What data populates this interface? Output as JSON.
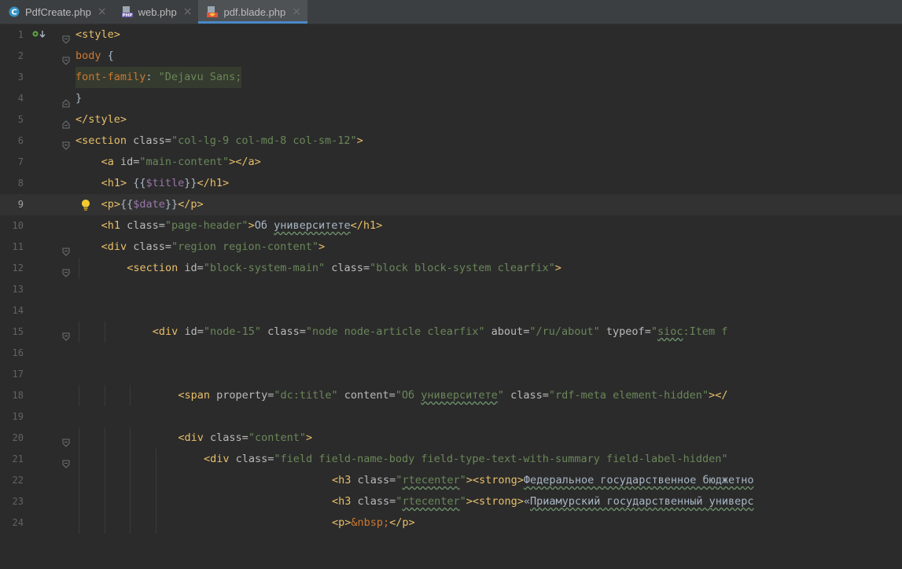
{
  "tabs": [
    {
      "label": "PdfCreate.php",
      "icon": "php-class-icon",
      "active": false
    },
    {
      "label": "web.php",
      "icon": "php-file-icon",
      "active": false
    },
    {
      "label": "pdf.blade.php",
      "icon": "blade-file-icon",
      "active": true
    }
  ],
  "tab_close_glyph": "×",
  "colors": {
    "tag": "#e8bf6a",
    "string": "#6a8759",
    "variable": "#9876aa",
    "text": "#a9b7c6",
    "keyword": "#cc7832",
    "active_tab_underline": "#4a88c7"
  },
  "lines": [
    {
      "n": "1",
      "indent": 0,
      "fold": "open",
      "mark": "implemented",
      "segs": [
        [
          "tag",
          "<style>"
        ]
      ]
    },
    {
      "n": "2",
      "indent": 0,
      "fold": "open",
      "segs": [
        [
          "css",
          "body"
        ],
        [
          "text",
          " {"
        ]
      ]
    },
    {
      "n": "3",
      "indent": 0,
      "cssbg": true,
      "segs": [
        [
          "css",
          "font-family"
        ],
        [
          "text",
          ": "
        ],
        [
          "str",
          "\"Dejavu Sans;"
        ]
      ]
    },
    {
      "n": "4",
      "indent": 0,
      "fold": "close",
      "segs": [
        [
          "text",
          "}"
        ]
      ]
    },
    {
      "n": "5",
      "indent": 0,
      "fold": "close",
      "segs": [
        [
          "tag",
          "</style>"
        ]
      ]
    },
    {
      "n": "6",
      "indent": 0,
      "fold": "open",
      "segs": [
        [
          "tag",
          "<section "
        ],
        [
          "attr",
          "class="
        ],
        [
          "str",
          "\"col-lg-9 col-md-8 col-sm-12\""
        ],
        [
          "tag",
          ">"
        ]
      ]
    },
    {
      "n": "7",
      "indent": 1,
      "segs": [
        [
          "tag",
          "<a "
        ],
        [
          "attr",
          "id="
        ],
        [
          "str",
          "\"main-content\""
        ],
        [
          "tag",
          "></a>"
        ]
      ]
    },
    {
      "n": "8",
      "indent": 1,
      "segs": [
        [
          "tag",
          "<h1>"
        ],
        [
          "text",
          " {{"
        ],
        [
          "var",
          "$title"
        ],
        [
          "text",
          "}}"
        ],
        [
          "tag",
          "</h1>"
        ]
      ]
    },
    {
      "n": "9",
      "indent": 1,
      "current": true,
      "bulb": true,
      "segs": [
        [
          "tag",
          "<p>"
        ],
        [
          "text",
          "{{"
        ],
        [
          "var",
          "$date"
        ],
        [
          "text",
          "}}"
        ],
        [
          "tag",
          "</p>"
        ]
      ]
    },
    {
      "n": "10",
      "indent": 1,
      "segs": [
        [
          "tag",
          "<h1 "
        ],
        [
          "attr",
          "class="
        ],
        [
          "str",
          "\"page-header\""
        ],
        [
          "tag",
          ">"
        ],
        [
          "text",
          "Об "
        ],
        [
          "textsq",
          "университете"
        ],
        [
          "tag",
          "</h1>"
        ]
      ]
    },
    {
      "n": "11",
      "indent": 1,
      "fold": "open",
      "segs": [
        [
          "tag",
          "<div "
        ],
        [
          "attr",
          "class="
        ],
        [
          "str",
          "\"region region-content\""
        ],
        [
          "tag",
          ">"
        ]
      ]
    },
    {
      "n": "12",
      "indent": 2,
      "fold": "open",
      "segs": [
        [
          "tag",
          "<section "
        ],
        [
          "attr",
          "id="
        ],
        [
          "str",
          "\"block-system-main\" "
        ],
        [
          "attr",
          "class="
        ],
        [
          "str",
          "\"block block-system clearfix\""
        ],
        [
          "tag",
          ">"
        ]
      ]
    },
    {
      "n": "13",
      "indent": 0,
      "segs": []
    },
    {
      "n": "14",
      "indent": 0,
      "segs": []
    },
    {
      "n": "15",
      "indent": 3,
      "fold": "open",
      "segs": [
        [
          "tag",
          "<div "
        ],
        [
          "attr",
          "id="
        ],
        [
          "str",
          "\"node-15\" "
        ],
        [
          "attr",
          "class="
        ],
        [
          "str",
          "\"node node-article clearfix\" "
        ],
        [
          "attr",
          "about="
        ],
        [
          "str",
          "\"/ru/about\" "
        ],
        [
          "attr",
          "typeof="
        ],
        [
          "str",
          "\""
        ],
        [
          "strsq",
          "sioc"
        ],
        [
          "str",
          ":Item f"
        ]
      ]
    },
    {
      "n": "16",
      "indent": 0,
      "segs": []
    },
    {
      "n": "17",
      "indent": 0,
      "segs": []
    },
    {
      "n": "18",
      "indent": 4,
      "segs": [
        [
          "tag",
          "<span "
        ],
        [
          "attr",
          "property="
        ],
        [
          "str",
          "\"dc:title\" "
        ],
        [
          "attr",
          "content="
        ],
        [
          "str",
          "\"Об "
        ],
        [
          "strsq",
          "университете"
        ],
        [
          "str",
          "\" "
        ],
        [
          "attr",
          "class="
        ],
        [
          "str",
          "\"rdf-meta element-hidden\""
        ],
        [
          "tag",
          "></"
        ]
      ]
    },
    {
      "n": "19",
      "indent": 0,
      "segs": []
    },
    {
      "n": "20",
      "indent": 4,
      "fold": "open",
      "segs": [
        [
          "tag",
          "<div "
        ],
        [
          "attr",
          "class="
        ],
        [
          "str",
          "\"content\""
        ],
        [
          "tag",
          ">"
        ]
      ]
    },
    {
      "n": "21",
      "indent": 5,
      "fold": "open",
      "segs": [
        [
          "tag",
          "<div "
        ],
        [
          "attr",
          "class="
        ],
        [
          "str",
          "\"field field-name-body field-type-text-with-summary field-label-hidden\""
        ]
      ]
    },
    {
      "n": "22",
      "indent": 10,
      "segs": [
        [
          "tag",
          "<h3 "
        ],
        [
          "attr",
          "class="
        ],
        [
          "str",
          "\""
        ],
        [
          "strsq",
          "rtecenter"
        ],
        [
          "str",
          "\""
        ],
        [
          "tag",
          "><strong>"
        ],
        [
          "textsq",
          "Федеральное государственное бюджетно"
        ]
      ]
    },
    {
      "n": "23",
      "indent": 10,
      "segs": [
        [
          "tag",
          "<h3 "
        ],
        [
          "attr",
          "class="
        ],
        [
          "str",
          "\""
        ],
        [
          "strsq",
          "rtecenter"
        ],
        [
          "str",
          "\""
        ],
        [
          "tag",
          "><strong>"
        ],
        [
          "text",
          "«"
        ],
        [
          "textsq",
          "Приамурский государственный универс"
        ]
      ]
    },
    {
      "n": "24",
      "indent": 10,
      "segs": [
        [
          "tag",
          "<p>"
        ],
        [
          "css",
          "&nbsp;"
        ],
        [
          "tag",
          "</p>"
        ]
      ]
    }
  ]
}
